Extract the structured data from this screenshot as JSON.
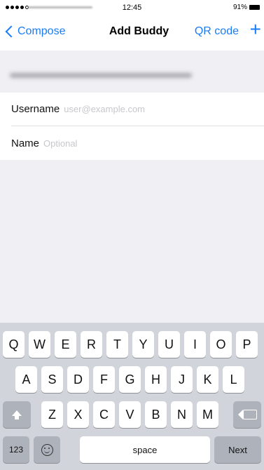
{
  "status_bar": {
    "time": "12:45",
    "battery_percent": "91%"
  },
  "nav": {
    "back_label": "Compose",
    "title": "Add Buddy",
    "qr_label": "QR code",
    "add_glyph": "+"
  },
  "form": {
    "username": {
      "label": "Username",
      "placeholder": "user@example.com",
      "value": ""
    },
    "name": {
      "label": "Name",
      "placeholder": "Optional",
      "value": ""
    }
  },
  "keyboard": {
    "row1": [
      "Q",
      "W",
      "E",
      "R",
      "T",
      "Y",
      "U",
      "I",
      "O",
      "P"
    ],
    "row2": [
      "A",
      "S",
      "D",
      "F",
      "G",
      "H",
      "J",
      "K",
      "L"
    ],
    "row3": [
      "Z",
      "X",
      "C",
      "V",
      "B",
      "N",
      "M"
    ],
    "numbers_label": "123",
    "space_label": "space",
    "next_label": "Next"
  },
  "colors": {
    "accent": "#1a7cf5",
    "background_gray": "#efeff4",
    "keyboard_bg": "#d1d5db"
  }
}
